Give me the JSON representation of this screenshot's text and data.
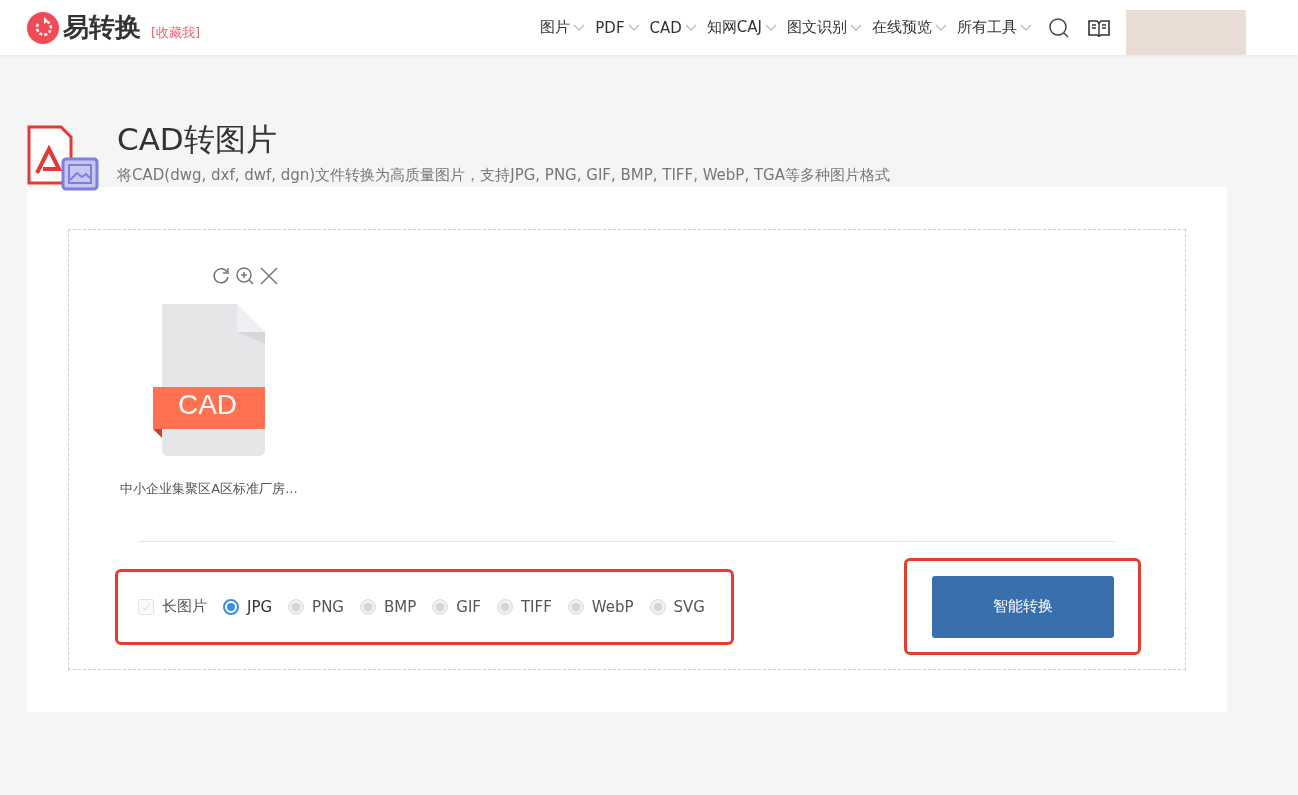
{
  "header": {
    "logo_text": "易转换",
    "bookmark_link": "[收藏我]",
    "nav": [
      {
        "label": "图片"
      },
      {
        "label": "PDF"
      },
      {
        "label": "CAD"
      },
      {
        "label": "知网CAJ"
      },
      {
        "label": "图文识别"
      },
      {
        "label": "在线预览"
      },
      {
        "label": "所有工具"
      }
    ]
  },
  "page": {
    "title": "CAD转图片",
    "description": "将CAD(dwg, dxf, dwf, dgn)文件转换为高质量图片，支持JPG, PNG, GIF, BMP, TIFF, WebP, TGA等多种图片格式"
  },
  "file": {
    "badge": "CAD",
    "name": "中小企业集聚区A区标准厂房..."
  },
  "options": {
    "long_image": {
      "label": "长图片",
      "checked": false,
      "disabled": true
    },
    "formats": [
      {
        "label": "JPG",
        "selected": true,
        "disabled": false
      },
      {
        "label": "PNG",
        "selected": false,
        "disabled": true
      },
      {
        "label": "BMP",
        "selected": false,
        "disabled": true
      },
      {
        "label": "GIF",
        "selected": false,
        "disabled": true
      },
      {
        "label": "TIFF",
        "selected": false,
        "disabled": true
      },
      {
        "label": "WebP",
        "selected": false,
        "disabled": true
      },
      {
        "label": "SVG",
        "selected": false,
        "disabled": true
      }
    ]
  },
  "convert_button": "智能转换"
}
